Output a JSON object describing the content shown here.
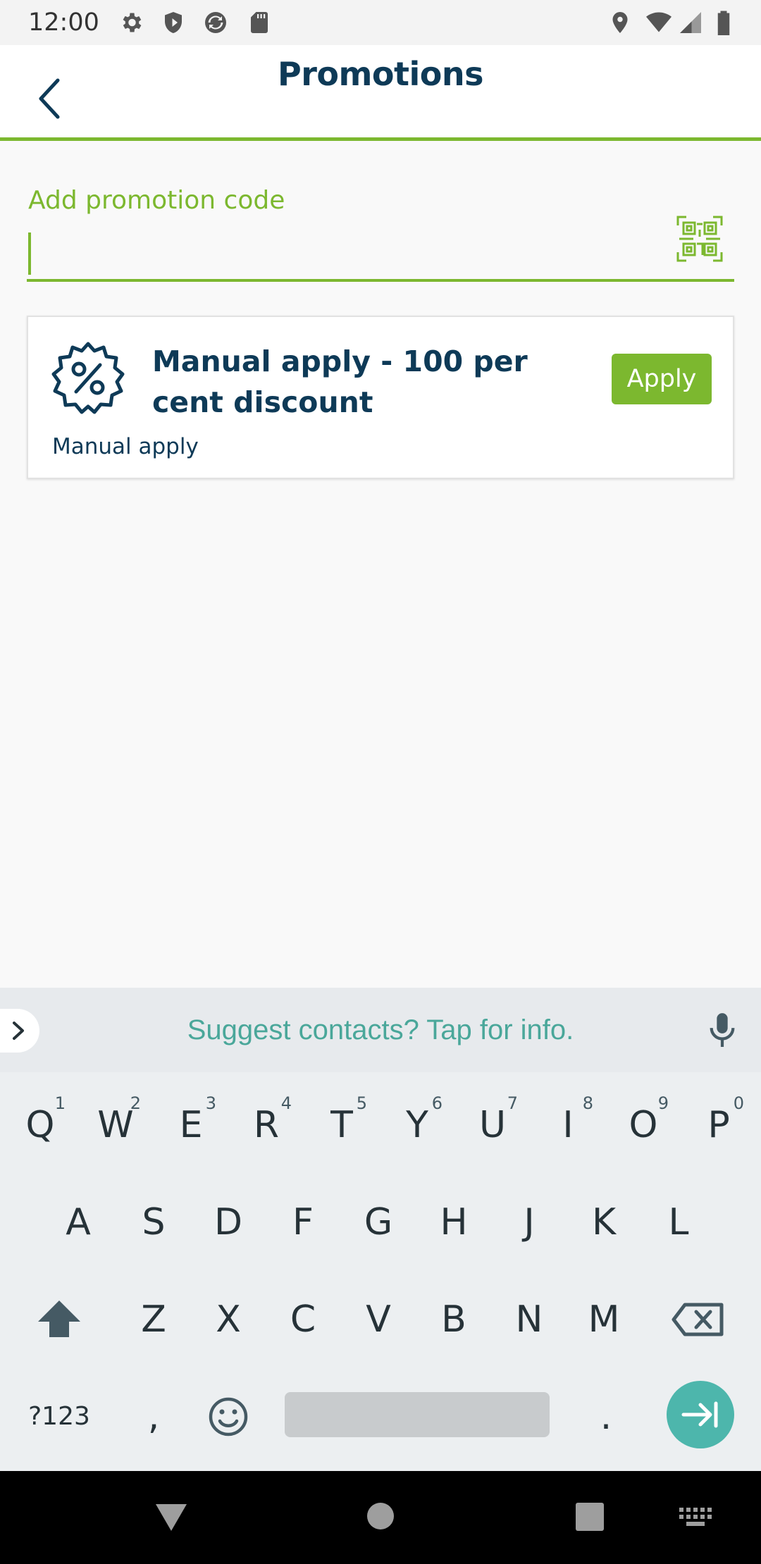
{
  "status_bar": {
    "time": "12:00",
    "icons_left": [
      "settings-icon",
      "shield-icon",
      "sync-icon",
      "sd-card-icon"
    ],
    "icons_right": [
      "location-icon",
      "wifi-icon",
      "signal-icon",
      "battery-icon"
    ]
  },
  "app_bar": {
    "title": "Promotions",
    "back_icon": "chevron-left-icon"
  },
  "promo_field": {
    "label": "Add promotion code",
    "value": "",
    "scan_icon": "qr-code-icon"
  },
  "promotions": [
    {
      "title": "Manual apply - 100 per cent discount",
      "subtitle": "Manual apply",
      "button": "Apply",
      "icon": "discount-badge-icon"
    }
  ],
  "keyboard": {
    "suggestion": "Suggest contacts? Tap for info.",
    "row1": [
      "Q",
      "W",
      "E",
      "R",
      "T",
      "Y",
      "U",
      "I",
      "O",
      "P"
    ],
    "row1_hints": [
      "1",
      "2",
      "3",
      "4",
      "5",
      "6",
      "7",
      "8",
      "9",
      "0"
    ],
    "row2": [
      "A",
      "S",
      "D",
      "F",
      "G",
      "H",
      "J",
      "K",
      "L"
    ],
    "row3": [
      "Z",
      "X",
      "C",
      "V",
      "B",
      "N",
      "M"
    ],
    "symbols_key": "?123",
    "comma": ",",
    "period": "."
  },
  "colors": {
    "accent": "#7cb82f",
    "title": "#0e3a57",
    "keyboard_accent": "#4db6ac"
  }
}
